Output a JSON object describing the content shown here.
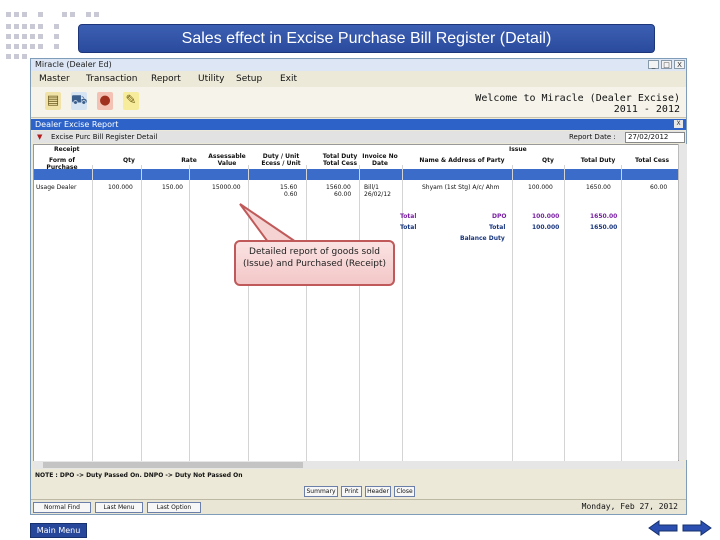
{
  "slide": {
    "banner_title": "Sales effect in Excise Purchase Bill Register (Detail)",
    "callout_text": "Detailed report of goods sold (Issue) and Purchased (Receipt)",
    "main_menu_label": "Main Menu",
    "nav_prev_icon": "arrow-left-icon",
    "nav_next_icon": "arrow-right-icon",
    "accent_color": "#2a4b9d"
  },
  "window": {
    "title": "Miracle (Dealer Ed)",
    "controls": [
      "_",
      "□",
      "X"
    ],
    "menu": [
      "Master",
      "Transaction",
      "Report",
      "Utility",
      "Setup",
      "Exit"
    ],
    "toolbar_icons": [
      "document-icon",
      "cart-icon",
      "money-bag-icon",
      "edit-icon"
    ],
    "welcome_line1": "Welcome to Miracle (Dealer Excise)",
    "welcome_line2": "2011 - 2012"
  },
  "report": {
    "window_title": "Dealer Excise Report",
    "panel_title": "Excise Purc Bill Register Detail",
    "report_date_label": "Report Date :",
    "report_date_value": "27/02/2012",
    "group_receipt": "Receipt",
    "group_issue": "Issue",
    "columns": [
      "Form of Purchase",
      "Qty",
      "Rate",
      "Assessable Value",
      "Duty / Unit Ecess / Unit",
      "Total Duty Total Cess",
      "Invoice No Date",
      "Name & Address of Party",
      "Qty",
      "Total Duty",
      "Total Cess"
    ],
    "row": {
      "form": "Usage Dealer",
      "qty": "100.000",
      "rate": "150.00",
      "assessable": "15000.00",
      "duty_unit": "15.60",
      "ecess_unit": "0.60",
      "total_duty": "1560.00",
      "total_cess": "60.00",
      "invoice_no": "Bill/1",
      "invoice_date": "26/02/12",
      "party": "Shyam (1st Stg) A/c/ Ahm",
      "issue_qty": "100.000",
      "issue_total_duty": "1650.00",
      "issue_total_cess": "60.00"
    },
    "totals": [
      {
        "label": "Total",
        "code": "DPO",
        "qty": "100.000",
        "duty": "1650.00"
      },
      {
        "label": "Total",
        "code": "Total",
        "qty": "100.000",
        "duty": "1650.00"
      }
    ],
    "balance_duty_label": "Balance Duty",
    "footer_note": "NOTE : DPO -> Duty Passed On.    DNPO -> Duty Not Passed On",
    "buttons": [
      "Summary",
      "Print",
      "Header",
      "Close"
    ],
    "status_buttons": [
      "Normal Find",
      "Last Menu",
      "Last Option"
    ],
    "status_date": "Monday, Feb 27, 2012"
  }
}
